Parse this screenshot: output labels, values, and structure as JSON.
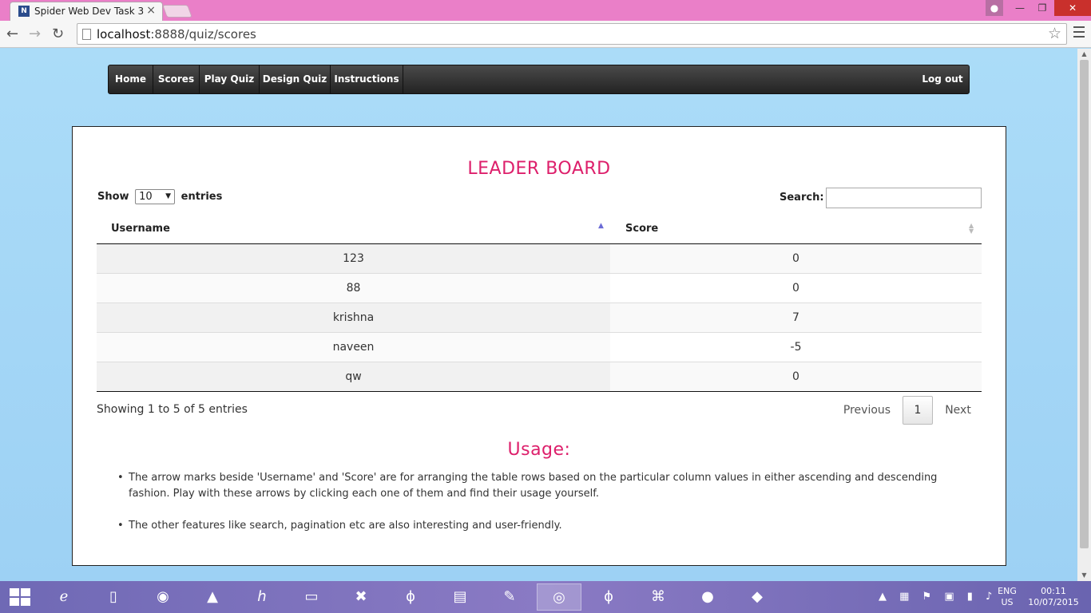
{
  "browser": {
    "tab_title": "Spider Web Dev Task 3",
    "tab_favicon": "N",
    "url_host": "localhost",
    "url_path": ":8888/quiz/scores"
  },
  "nav": {
    "home": "Home",
    "scores": "Scores",
    "play_quiz": "Play Quiz",
    "design_quiz": "Design Quiz",
    "instructions": "Instructions",
    "logout": "Log out"
  },
  "board": {
    "title": "LEADER BOARD",
    "show_label": "Show",
    "entries_label": "entries",
    "page_length": "10",
    "search_label": "Search:",
    "search_value": "",
    "columns": {
      "username": "Username",
      "score": "Score"
    },
    "rows": [
      {
        "username": "123",
        "score": "0"
      },
      {
        "username": "88",
        "score": "0"
      },
      {
        "username": "krishna",
        "score": "7"
      },
      {
        "username": "naveen",
        "score": "-5"
      },
      {
        "username": "qw",
        "score": "0"
      }
    ],
    "info": "Showing 1 to 5 of 5 entries",
    "pager": {
      "previous": "Previous",
      "current": "1",
      "next": "Next"
    }
  },
  "usage": {
    "title": "Usage:",
    "items": [
      "The arrow marks beside 'Username' and 'Score' are for arranging the table rows based on the particular column values in either ascending and descending fashion. Play with these arrows by clicking each one of them and find their usage yourself.",
      "The other features like search, pagination etc are also interesting and user-friendly."
    ]
  },
  "taskbar": {
    "lang": "ENG",
    "region": "US",
    "time": "00:11",
    "date": "10/07/2015"
  },
  "colors": {
    "accent_title": "#dd1f6b",
    "sort_arrow": "#6b6bd6",
    "nav_bg": "#2f2f2f"
  }
}
